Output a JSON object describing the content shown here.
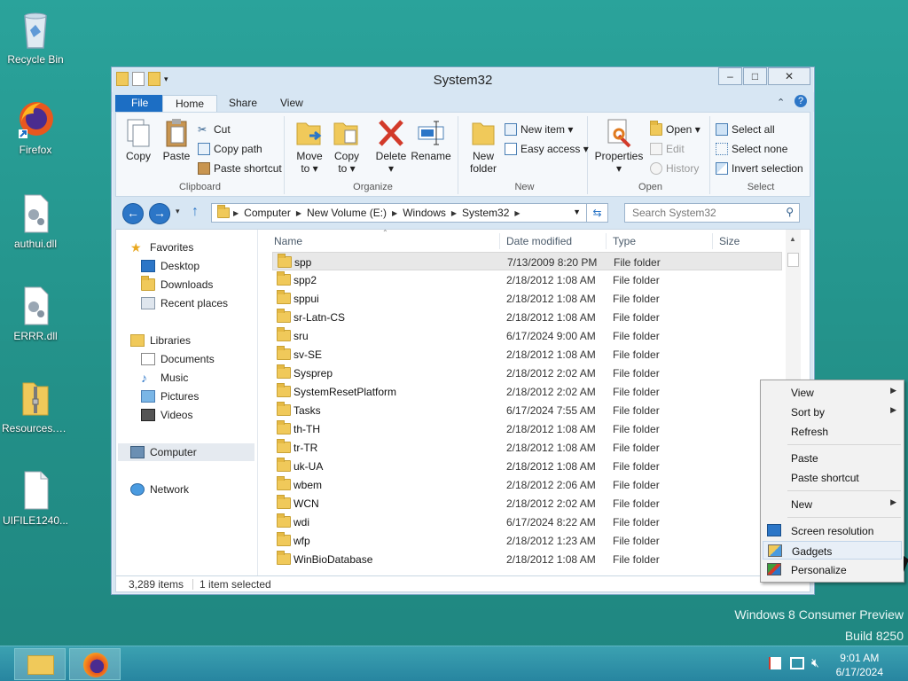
{
  "desktop": {
    "icons": [
      {
        "label": "Recycle Bin",
        "icon": "recycle-bin-icon"
      },
      {
        "label": "Firefox",
        "icon": "firefox-icon"
      },
      {
        "label": "authui.dll",
        "icon": "dll-file-icon"
      },
      {
        "label": "ERRR.dll",
        "icon": "dll-file-icon"
      },
      {
        "label": "Resources.zip",
        "icon": "zip-folder-icon"
      },
      {
        "label": "UIFILE1240...",
        "icon": "blank-file-icon"
      }
    ],
    "watermark_line1": "Windows 8 Consumer Preview",
    "watermark_line2": "Build 8250"
  },
  "window": {
    "title": "System32",
    "buttons": {
      "minimize": "‒",
      "maximize": "□",
      "close": "✕"
    },
    "tabs": [
      "File",
      "Home",
      "Share",
      "View"
    ],
    "active_tab": "Home"
  },
  "ribbon": {
    "clipboard": {
      "title": "Clipboard",
      "copy": "Copy",
      "paste": "Paste",
      "cut": "Cut",
      "copy_path": "Copy path",
      "paste_shortcut": "Paste shortcut"
    },
    "organize": {
      "title": "Organize",
      "move_to": "Move",
      "move_to_2": "to ▾",
      "copy_to": "Copy",
      "copy_to_2": "to ▾",
      "delete": "Delete",
      "delete_2": "▾",
      "rename": "Rename"
    },
    "new": {
      "title": "New",
      "new_folder": "New",
      "new_folder_2": "folder",
      "new_item": "New item ▾",
      "easy_access": "Easy access ▾"
    },
    "open": {
      "title": "Open",
      "properties": "Properties",
      "properties_2": "▾",
      "open": "Open ▾",
      "edit": "Edit",
      "history": "History"
    },
    "select": {
      "title": "Select",
      "select_all": "Select all",
      "select_none": "Select none",
      "invert_selection": "Invert selection"
    }
  },
  "nav": {
    "back": "←",
    "forward": "→",
    "up": "↑",
    "breadcrumbs": [
      "Computer",
      "New Volume (E:)",
      "Windows",
      "System32"
    ],
    "search_placeholder": "Search System32"
  },
  "navpane": {
    "favorites": "Favorites",
    "desktop": "Desktop",
    "downloads": "Downloads",
    "recent": "Recent places",
    "libraries": "Libraries",
    "documents": "Documents",
    "music": "Music",
    "pictures": "Pictures",
    "videos": "Videos",
    "computer": "Computer",
    "network": "Network"
  },
  "files": {
    "columns": [
      "Name",
      "Date modified",
      "Type",
      "Size"
    ],
    "rows": [
      {
        "name": "spp",
        "date": "7/13/2009 8:20 PM",
        "type": "File folder",
        "selected": true
      },
      {
        "name": "spp2",
        "date": "2/18/2012 1:08 AM",
        "type": "File folder"
      },
      {
        "name": "sppui",
        "date": "2/18/2012 1:08 AM",
        "type": "File folder"
      },
      {
        "name": "sr-Latn-CS",
        "date": "2/18/2012 1:08 AM",
        "type": "File folder"
      },
      {
        "name": "sru",
        "date": "6/17/2024 9:00 AM",
        "type": "File folder"
      },
      {
        "name": "sv-SE",
        "date": "2/18/2012 1:08 AM",
        "type": "File folder"
      },
      {
        "name": "Sysprep",
        "date": "2/18/2012 2:02 AM",
        "type": "File folder"
      },
      {
        "name": "SystemResetPlatform",
        "date": "2/18/2012 2:02 AM",
        "type": "File folder"
      },
      {
        "name": "Tasks",
        "date": "6/17/2024 7:55 AM",
        "type": "File folder"
      },
      {
        "name": "th-TH",
        "date": "2/18/2012 1:08 AM",
        "type": "File folder"
      },
      {
        "name": "tr-TR",
        "date": "2/18/2012 1:08 AM",
        "type": "File folder"
      },
      {
        "name": "uk-UA",
        "date": "2/18/2012 1:08 AM",
        "type": "File folder"
      },
      {
        "name": "wbem",
        "date": "2/18/2012 2:06 AM",
        "type": "File folder"
      },
      {
        "name": "WCN",
        "date": "2/18/2012 2:02 AM",
        "type": "File folder"
      },
      {
        "name": "wdi",
        "date": "6/17/2024 8:22 AM",
        "type": "File folder"
      },
      {
        "name": "wfp",
        "date": "2/18/2012 1:23 AM",
        "type": "File folder"
      },
      {
        "name": "WinBioDatabase",
        "date": "2/18/2012 1:08 AM",
        "type": "File folder"
      }
    ]
  },
  "status": {
    "count": "3,289 items",
    "selection": "1 item selected"
  },
  "context_menu": {
    "view": "View",
    "sort_by": "Sort by",
    "refresh": "Refresh",
    "paste": "Paste",
    "paste_shortcut": "Paste shortcut",
    "new": "New",
    "screen_resolution": "Screen resolution",
    "gadgets": "Gadgets",
    "personalize": "Personalize",
    "highlighted": "Gadgets"
  },
  "taskbar": {
    "apps": [
      "file-explorer-icon",
      "firefox-icon"
    ],
    "time": "9:01 AM",
    "date": "6/17/2024"
  },
  "colors": {
    "accent": "#1c6ec4",
    "desktop": "#2a9d96",
    "folder": "#f0c95a"
  }
}
